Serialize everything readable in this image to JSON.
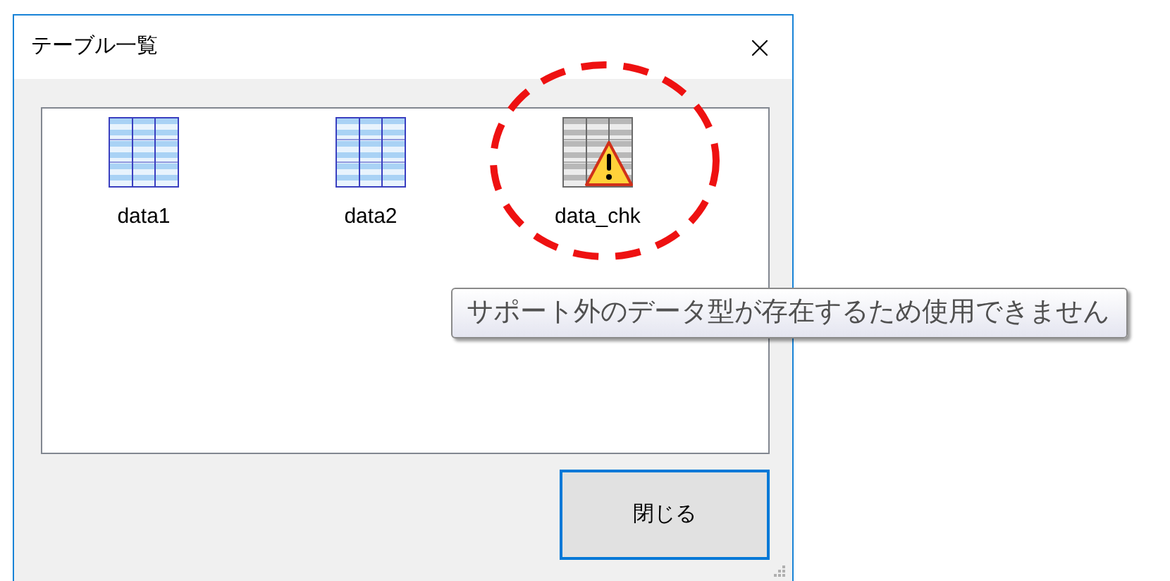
{
  "window": {
    "title": "テーブル一覧"
  },
  "items": [
    {
      "kind": "table",
      "label": "data1"
    },
    {
      "kind": "table",
      "label": "data2"
    },
    {
      "kind": "warning",
      "label": "data_chk"
    }
  ],
  "tooltip": "サポート外のデータ型が存在するため使用できません",
  "buttons": [
    "閉じる"
  ]
}
